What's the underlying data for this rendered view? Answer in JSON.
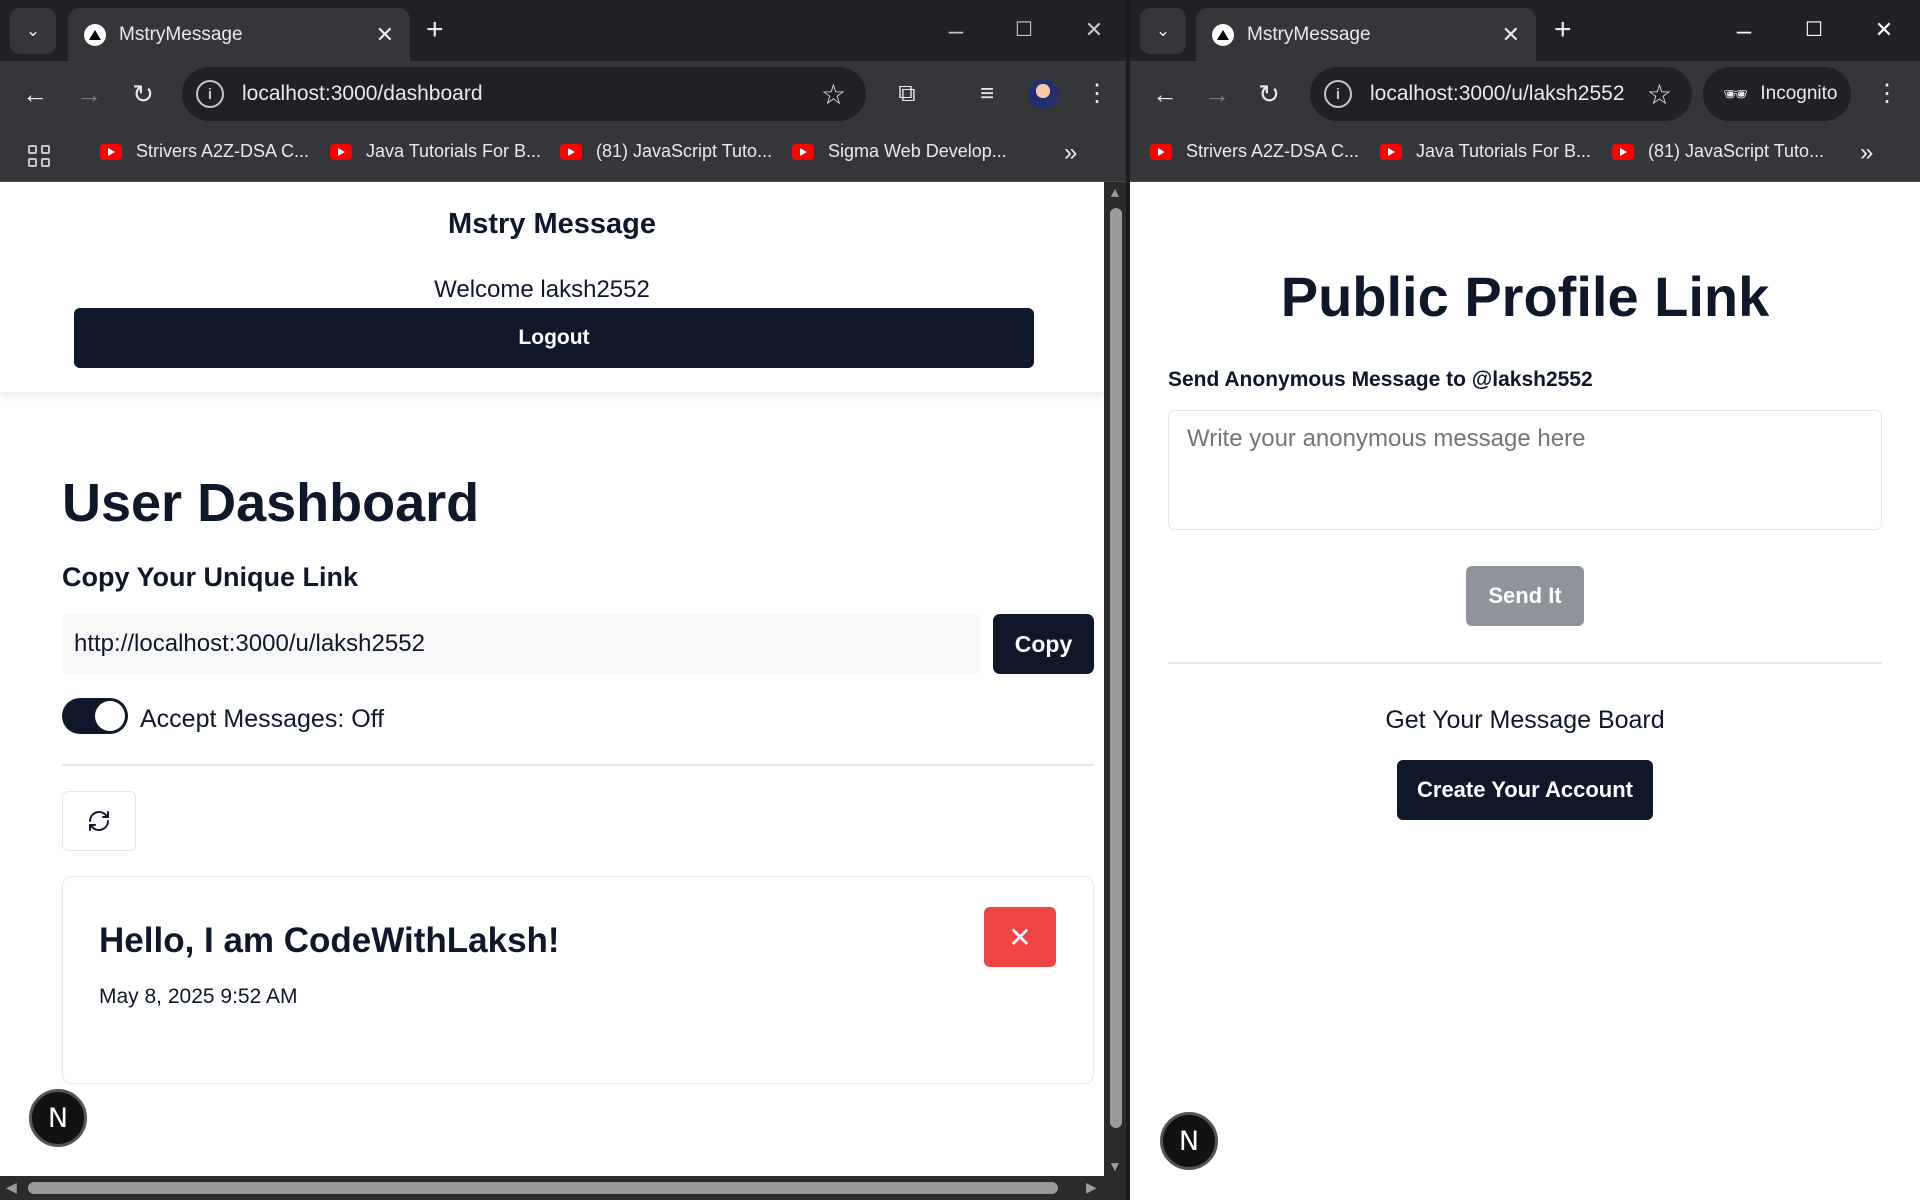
{
  "left": {
    "tab": {
      "title": "MstryMessage",
      "close": "✕"
    },
    "address": "localhost:3000/dashboard",
    "bookmarks": [
      "Strivers A2Z-DSA C...",
      "Java Tutorials For B...",
      "(81) JavaScript Tuto...",
      "Sigma Web Develop..."
    ],
    "app": {
      "brand": "Mstry Message",
      "welcome": "Welcome laksh2552",
      "logout": "Logout",
      "dashboard_title": "User Dashboard",
      "copy_label": "Copy Your Unique Link",
      "link": "http://localhost:3000/u/laksh2552",
      "copy_button": "Copy",
      "accept_messages": "Accept Messages: Off",
      "message": {
        "title": "Hello, I am CodeWithLaksh!",
        "date": "May 8, 2025 9:52 AM"
      }
    }
  },
  "right": {
    "tab": {
      "title": "MstryMessage",
      "close": "✕"
    },
    "address": "localhost:3000/u/laksh2552",
    "incognito": "Incognito",
    "bookmarks": [
      "Strivers A2Z-DSA C...",
      "Java Tutorials For B...",
      "(81) JavaScript Tuto..."
    ],
    "app": {
      "title": "Public Profile Link",
      "label": "Send Anonymous Message to @laksh2552",
      "placeholder": "Write your anonymous message here",
      "send": "Send It",
      "get_board": "Get Your Message Board",
      "create": "Create Your Account"
    }
  },
  "nextjs_badge": "N",
  "colors": {
    "primary": "#0f172a",
    "danger": "#ef4444",
    "disabled": "#8e939c",
    "chrome_dark": "#35363a"
  }
}
